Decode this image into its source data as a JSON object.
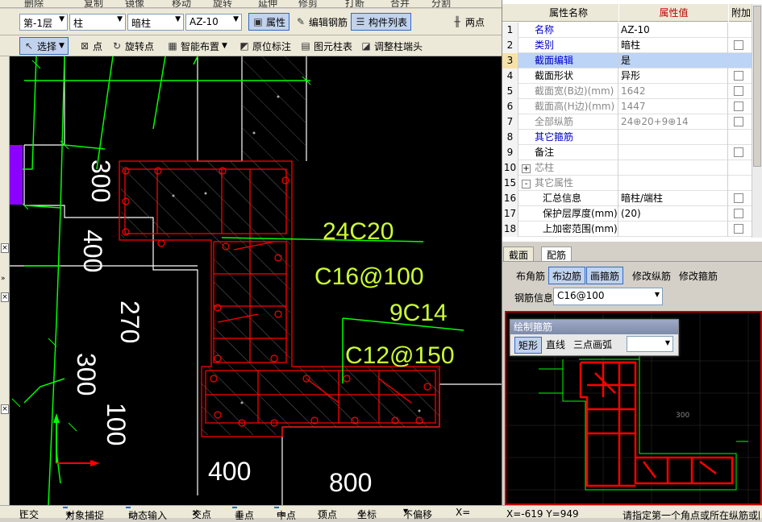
{
  "top_partial": [
    "删除",
    "复制",
    "镜像",
    "移动",
    "旋转",
    "延伸",
    "修剪",
    "打断",
    "合并",
    "分割"
  ],
  "toolbar1": {
    "floor": "第-1层",
    "category": "柱",
    "type": "暗柱",
    "component": "AZ-10",
    "properties": "属性",
    "edit_rebar": "编辑钢筋",
    "component_list": "构件列表",
    "two_point": "两点"
  },
  "toolbar2": {
    "select": "选择",
    "point": "点",
    "rotate_point": "旋转点",
    "smart_layout": "智能布置",
    "in_place_annotation": "原位标注",
    "column_table": "图元柱表",
    "adjust_column_end": "调整柱端头"
  },
  "canvas": {
    "dims": [
      "300",
      "400",
      "270",
      "300",
      "100",
      "400",
      "800"
    ],
    "rebar_texts": [
      "24C20",
      "C16@100",
      "9C14",
      "C12@150"
    ]
  },
  "status_bar": {
    "ortho": "正交",
    "object_snap": "对象捕捉",
    "dynamic_input": "动态输入",
    "intersection": "交点",
    "perpendicular": "垂点",
    "midpoint": "中点",
    "vertex": "顶点",
    "coordinate": "坐标",
    "no_offset": "不偏移",
    "x_label": "X="
  },
  "properties": {
    "headers": {
      "name": "属性名称",
      "value": "属性值",
      "extra": "附加"
    },
    "rows": [
      {
        "num": "1",
        "name": "名称",
        "value": "AZ-10",
        "style": "blue",
        "check": false,
        "exp": ""
      },
      {
        "num": "2",
        "name": "类别",
        "value": "暗柱",
        "style": "blue",
        "check": true,
        "exp": ""
      },
      {
        "num": "3",
        "name": "截面编辑",
        "value": "是",
        "style": "blue",
        "check": false,
        "exp": ""
      },
      {
        "num": "4",
        "name": "截面形状",
        "value": "异形",
        "style": "",
        "check": true,
        "exp": ""
      },
      {
        "num": "5",
        "name": "截面宽(B边)(mm)",
        "value": "1642",
        "style": "gray",
        "check": true,
        "exp": ""
      },
      {
        "num": "6",
        "name": "截面高(H边)(mm)",
        "value": "1447",
        "style": "gray",
        "check": true,
        "exp": ""
      },
      {
        "num": "7",
        "name": "全部纵筋",
        "value": "24⊕20+9⊕14",
        "style": "gray",
        "check": true,
        "exp": ""
      },
      {
        "num": "8",
        "name": "其它箍筋",
        "value": "",
        "style": "blue",
        "check": false,
        "exp": ""
      },
      {
        "num": "9",
        "name": "备注",
        "value": "",
        "style": "",
        "check": true,
        "exp": ""
      },
      {
        "num": "10",
        "name": "芯柱",
        "value": "",
        "style": "gray",
        "check": false,
        "exp": "+"
      },
      {
        "num": "15",
        "name": "其它属性",
        "value": "",
        "style": "gray",
        "check": false,
        "exp": "-"
      },
      {
        "num": "16",
        "name": "汇总信息",
        "value": "暗柱/端柱",
        "style": "",
        "check": true,
        "exp": ""
      },
      {
        "num": "17",
        "name": "保护层厚度(mm)",
        "value": "(20)",
        "style": "",
        "check": true,
        "exp": ""
      },
      {
        "num": "18",
        "name": "上加密范围(mm)",
        "value": "",
        "style": "",
        "check": true,
        "exp": ""
      }
    ]
  },
  "lower_panel": {
    "tab_section": "截面",
    "tab_rebar": "配筋",
    "buttons": [
      "布角筋",
      "布边筋",
      "画箍筋",
      "修改纵筋",
      "修改箍筋"
    ],
    "rebar_info_label": "钢筋信息",
    "rebar_info_value": "C16@100",
    "popup_title": "绘制箍筋",
    "popup_buttons": [
      "矩形",
      "直线",
      "三点画弧"
    ],
    "preview_label": "300"
  },
  "bottom_right_status": {
    "coords": "X=-619 Y=949",
    "hint": "请指定第一个角点或所在纵筋或网"
  },
  "colors": {
    "canvas_bg": "#000000",
    "axis_green": "#00ff00",
    "rebar_red": "#ff0000",
    "text_yellow": "#ccff33",
    "selected_row": "#bcd4f6"
  }
}
